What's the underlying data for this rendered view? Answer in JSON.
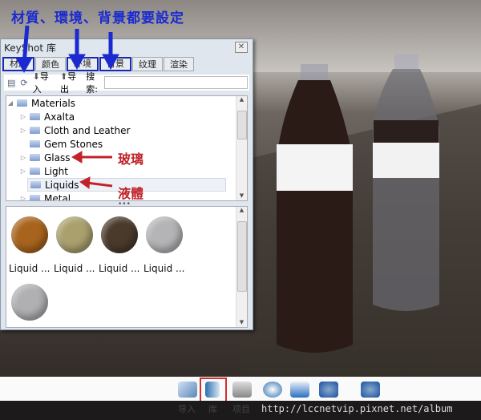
{
  "annotation": {
    "headline": "材質、環境、背景都要設定",
    "glass_note": "玻璃",
    "liquids_note": "液體",
    "arrow_color": "#1a2ad0",
    "note_color": "#c0242a"
  },
  "window": {
    "title": "KeyShot 库",
    "close_icon": "close-icon",
    "tabs": [
      {
        "label": "材质",
        "highlighted": true
      },
      {
        "label": "颜色",
        "highlighted": false
      },
      {
        "label": "环境",
        "highlighted": true
      },
      {
        "label": "背景",
        "highlighted": true
      },
      {
        "label": "纹理",
        "highlighted": false
      },
      {
        "label": "渲染",
        "highlighted": false
      }
    ],
    "toolbar": {
      "import_label": "导入",
      "export_label": "导出",
      "search_label": "搜索:",
      "search_value": ""
    },
    "tree": {
      "root": "Materials",
      "items": [
        {
          "label": "Axalta",
          "expandable": true
        },
        {
          "label": "Cloth and Leather",
          "expandable": true
        },
        {
          "label": "Gem Stones",
          "expandable": false
        },
        {
          "label": "Glass",
          "expandable": true
        },
        {
          "label": "Light",
          "expandable": true
        },
        {
          "label": "Liquids",
          "expandable": false,
          "selected": true
        },
        {
          "label": "Metal",
          "expandable": true
        }
      ]
    },
    "swatches": [
      {
        "label": "Liquid ...",
        "color": "#a8641c"
      },
      {
        "label": "Liquid ...",
        "color": "#a9a06e"
      },
      {
        "label": "Liquid ...",
        "color": "#4a3a2c"
      },
      {
        "label": "Liquid ...",
        "color": "#b4b4b6"
      },
      {
        "label": "",
        "color": "#b0b0b2"
      }
    ]
  },
  "bottom": {
    "labels": [
      "导入",
      "库",
      "项目"
    ],
    "url": "http://lccnetvip.pixnet.net/album"
  }
}
